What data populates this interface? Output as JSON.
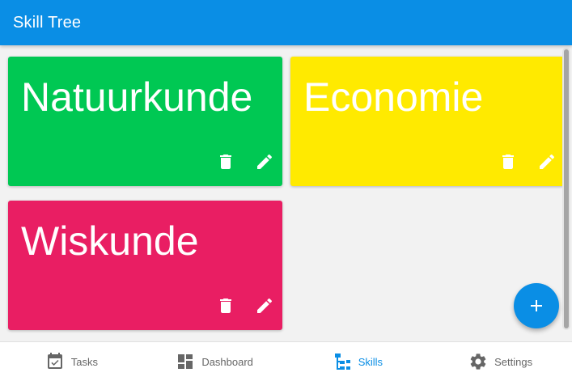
{
  "app": {
    "title": "Skill Tree",
    "primary_color": "#0a8ee5",
    "background_color": "#f2f2f2"
  },
  "skills": [
    {
      "name": "Natuurkunde",
      "color": "#00c853"
    },
    {
      "name": "Economie",
      "color": "#ffea00"
    },
    {
      "name": "Wiskunde",
      "color": "#e91e63"
    }
  ],
  "card_actions": {
    "delete_icon": "trash-icon",
    "edit_icon": "pencil-icon"
  },
  "fab": {
    "icon": "plus-icon",
    "color": "#0a8ee5"
  },
  "bottom_nav": {
    "items": [
      {
        "label": "Tasks",
        "icon": "calendar-check-icon",
        "active": false
      },
      {
        "label": "Dashboard",
        "icon": "dashboard-icon",
        "active": false
      },
      {
        "label": "Skills",
        "icon": "skill-tree-icon",
        "active": true
      },
      {
        "label": "Settings",
        "icon": "gear-icon",
        "active": false
      }
    ]
  }
}
